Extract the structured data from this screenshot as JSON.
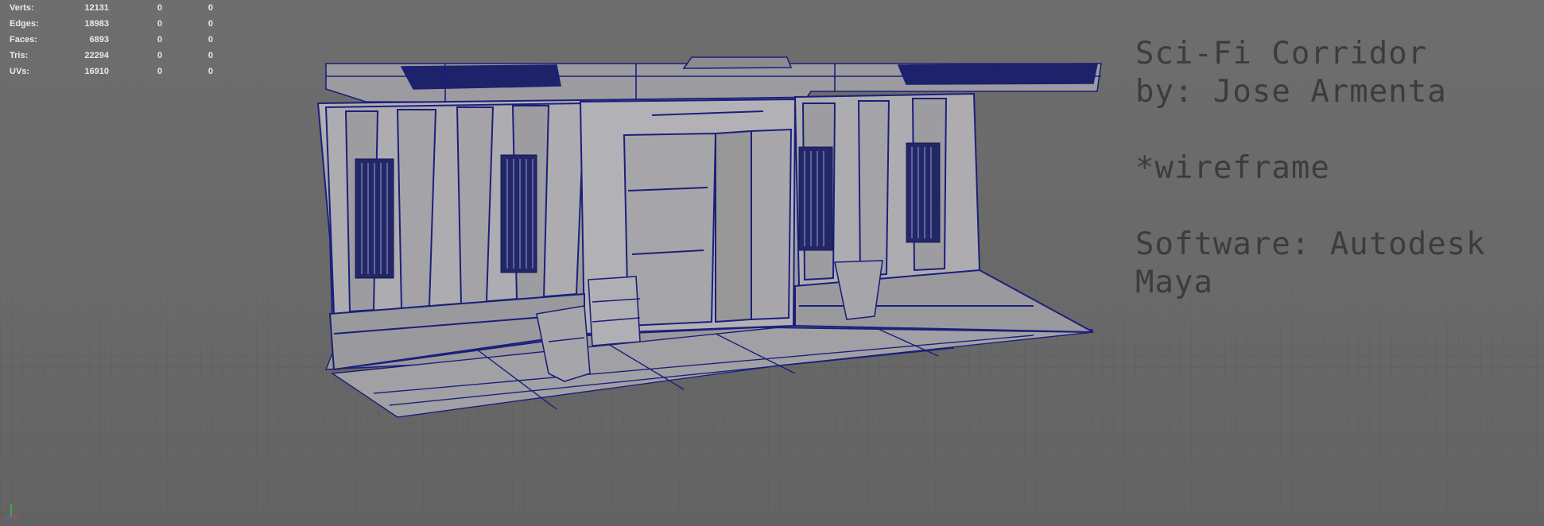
{
  "hud": {
    "rows": [
      {
        "label": "Verts:",
        "total": "12131",
        "selected": "0",
        "component": "0"
      },
      {
        "label": "Edges:",
        "total": "18983",
        "selected": "0",
        "component": "0"
      },
      {
        "label": "Faces:",
        "total": "6893",
        "selected": "0",
        "component": "0"
      },
      {
        "label": "Tris:",
        "total": "22294",
        "selected": "0",
        "component": "0"
      },
      {
        "label": "UVs:",
        "total": "16910",
        "selected": "0",
        "component": "0"
      }
    ]
  },
  "overlay": {
    "title": "Sci-Fi Corridor",
    "author": "by: Jose Armenta",
    "note": "*wireframe",
    "software_line1": "Software: Autodesk",
    "software_line2": "Maya"
  },
  "colors": {
    "wire": "#1c1f7a",
    "mesh_face": "#a8a8ac",
    "grid_line": "#5a5a5a",
    "hud_text": "#e9e9e9",
    "overlay_text": "#3c3c3c"
  },
  "icons": {
    "axis": "view-axis-gizmo-icon"
  }
}
